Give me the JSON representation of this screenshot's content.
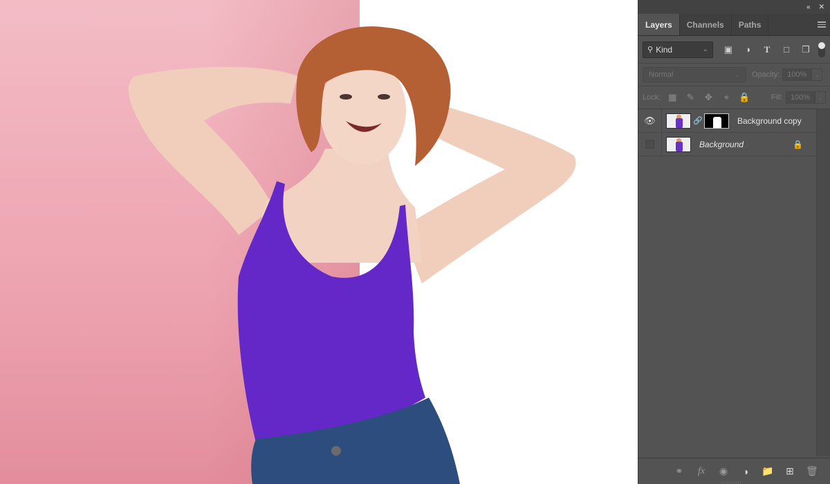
{
  "canvas": {
    "description": "Photo of smiling woman with short auburn hair, hands behind head, purple tank top and jeans, pink backdrop on left, white on right",
    "colors": {
      "pink": "#eda3b0",
      "white": "#ffffff",
      "top": "#6428c8",
      "denim": "#2c4d7e",
      "skin": "#f2d2c2",
      "hair": "#b55f35"
    }
  },
  "panel": {
    "collapse_icon": "«",
    "close_icon": "✕",
    "tabs": [
      {
        "label": "Layers",
        "active": true
      },
      {
        "label": "Channels",
        "active": false
      },
      {
        "label": "Paths",
        "active": false
      }
    ],
    "filter": {
      "search_icon": "🔍",
      "kind_label": "Kind",
      "chevron": "⌄"
    },
    "blend": {
      "mode": "Normal",
      "opacity_label": "Opacity:",
      "opacity_value": "100%"
    },
    "lock": {
      "label": "Lock:",
      "fill_label": "Fill:",
      "fill_value": "100%"
    },
    "layers": [
      {
        "name": "Background copy",
        "visible": true,
        "has_mask": true,
        "locked": false
      },
      {
        "name": "Background",
        "visible": false,
        "has_mask": false,
        "locked": true
      }
    ]
  }
}
